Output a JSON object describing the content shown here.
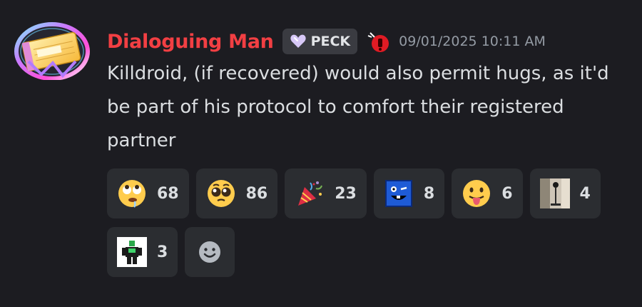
{
  "message": {
    "author": "Dialoguing Man",
    "tag": "PECK",
    "timestamp": "09/01/2025 10:11 AM",
    "text": "Killdroid, (if recovered) would also permit hugs, as it'd be part of his protocol to comfort their registered partner",
    "avatar_icon": "notebook-avatar-icon",
    "role_icon": "red-bomb-icon"
  },
  "reactions": [
    {
      "emoji": "rolling-eyes-drool-icon",
      "count": "68"
    },
    {
      "emoji": "pleading-face-icon",
      "count": "86"
    },
    {
      "emoji": "party-popper-icon",
      "count": "23"
    },
    {
      "emoji": "blue-square-face-icon",
      "count": "8"
    },
    {
      "emoji": "tongue-out-face-icon",
      "count": "6"
    },
    {
      "emoji": "microphone-photo-icon",
      "count": "4"
    },
    {
      "emoji": "green-robot-figure-icon",
      "count": "3"
    }
  ],
  "add_reaction": {
    "icon": "add-reaction-smile-icon"
  },
  "colors": {
    "background": "#1c1c21",
    "username": "#f23f43",
    "reaction_bg": "#2b2d31",
    "timestamp": "#949ba4"
  }
}
